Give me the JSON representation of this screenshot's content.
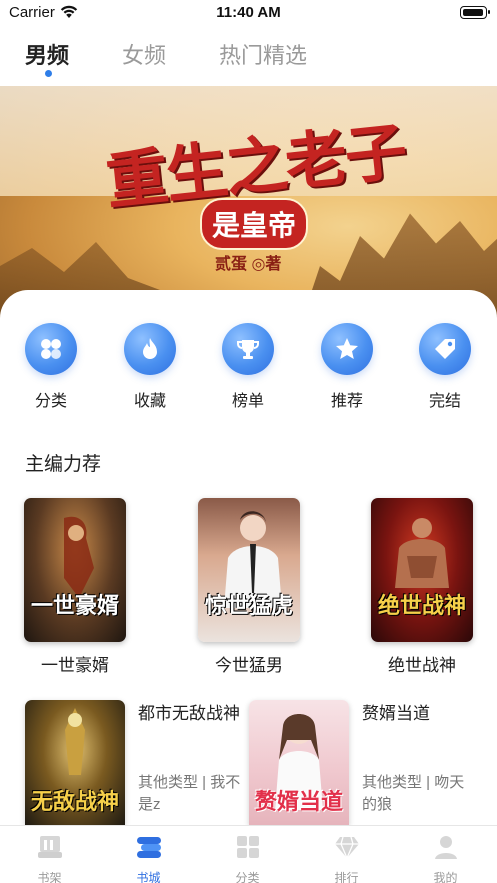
{
  "status_bar": {
    "carrier": "Carrier",
    "time": "11:40 AM"
  },
  "top_tabs": [
    {
      "label": "男频",
      "active": true
    },
    {
      "label": "女频",
      "active": false
    },
    {
      "label": "热门精选",
      "active": false
    }
  ],
  "banner": {
    "title": "重生之老子",
    "subtitle": "是皇帝",
    "author": "贰蛋 ◎著"
  },
  "categories": [
    {
      "label": "分类",
      "icon": "category-icon"
    },
    {
      "label": "收藏",
      "icon": "flame-icon"
    },
    {
      "label": "榜单",
      "icon": "trophy-icon"
    },
    {
      "label": "推荐",
      "icon": "star-icon"
    },
    {
      "label": "完结",
      "icon": "tag-icon"
    }
  ],
  "section": {
    "title": "主编力荐"
  },
  "recommended": [
    {
      "name": "一世豪婿",
      "cover_text": "一世豪婿"
    },
    {
      "name": "今世猛男",
      "cover_text": "惊世猛虎"
    },
    {
      "name": "绝世战神",
      "cover_text": "绝世战神"
    }
  ],
  "list": [
    {
      "title": "都市无敌战神",
      "meta": "其他类型 | 我不是z",
      "cover_text": "无敌战神"
    },
    {
      "title": "赘婿当道",
      "meta": "其他类型 | 吻天的狼",
      "cover_text": "赘婿当道"
    }
  ],
  "tabbar": [
    {
      "label": "书架",
      "icon": "bookshelf-icon",
      "active": false
    },
    {
      "label": "书城",
      "icon": "bookstore-icon",
      "active": true
    },
    {
      "label": "分类",
      "icon": "grid-icon",
      "active": false
    },
    {
      "label": "排行",
      "icon": "diamond-icon",
      "active": false
    },
    {
      "label": "我的",
      "icon": "profile-icon",
      "active": false
    }
  ],
  "colors": {
    "accent": "#2f6fe0",
    "inactive": "#9a9a9a",
    "banner_red": "#c42421"
  }
}
